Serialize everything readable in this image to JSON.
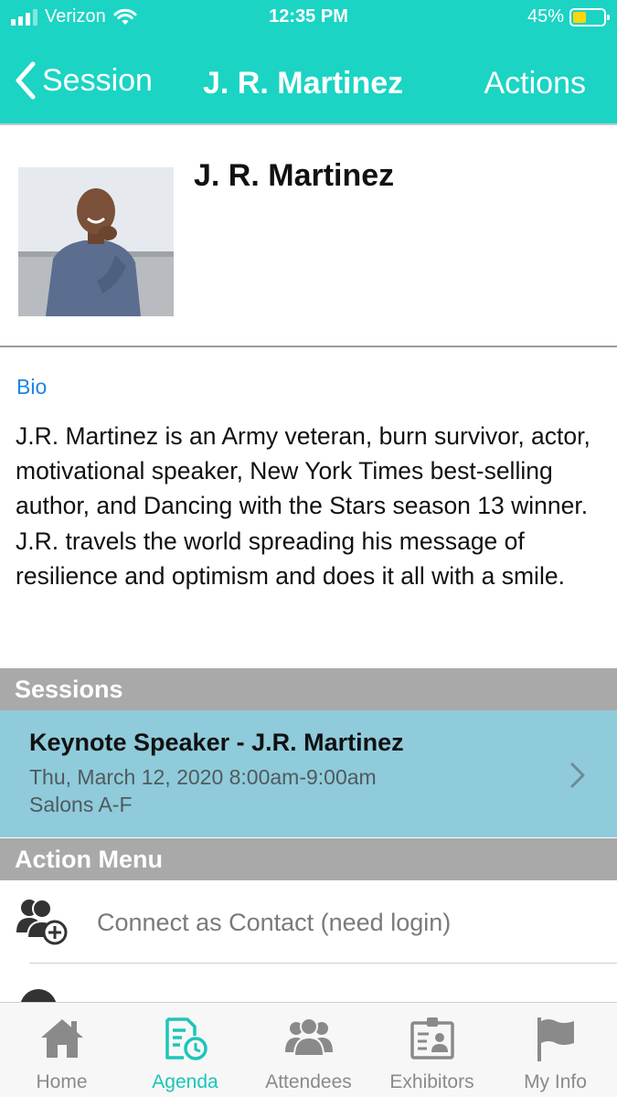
{
  "status_bar": {
    "carrier": "Verizon",
    "time": "12:35 PM",
    "battery_text": "45%",
    "battery_level": 0.45,
    "icons": [
      "cellular-signal-icon",
      "wifi-icon",
      "battery-icon"
    ]
  },
  "nav": {
    "back_label": "Session",
    "title": "J. R. Martinez",
    "actions_label": "Actions"
  },
  "profile": {
    "name": "J. R. Martinez"
  },
  "bio": {
    "label": "Bio",
    "text": "J.R. Martinez is an Army veteran, burn survivor, actor, motivational speaker, New York Times best-selling author, and Dancing with the Stars season 13 winner. J.R. travels the world spreading his message of resilience and optimism and does it all with a smile."
  },
  "sessions": {
    "header": "Sessions",
    "items": [
      {
        "title": "Keynote Speaker - J.R. Martinez",
        "time": "Thu, March 12, 2020 8:00am-9:00am",
        "room": "Salons A-F"
      }
    ]
  },
  "action_menu": {
    "header": "Action Menu",
    "items": [
      {
        "label": "Connect as Contact (need login)",
        "icon": "add-contact-icon"
      },
      {
        "label": "",
        "icon": "chat-icon"
      }
    ]
  },
  "tabbar": {
    "active": "Agenda",
    "tabs": [
      {
        "label": "Home",
        "icon": "home-icon"
      },
      {
        "label": "Agenda",
        "icon": "agenda-icon"
      },
      {
        "label": "Attendees",
        "icon": "attendees-icon"
      },
      {
        "label": "Exhibitors",
        "icon": "exhibitors-icon"
      },
      {
        "label": "My Info",
        "icon": "flag-icon"
      }
    ]
  },
  "colors": {
    "header_bg": "#1bd4c4",
    "accent_link": "#1a86e8",
    "section_header_bg": "#a9a9a9",
    "session_card_bg": "#8fcbdb",
    "tab_active": "#1bc6b8",
    "tab_inactive": "#8a8a8a"
  }
}
